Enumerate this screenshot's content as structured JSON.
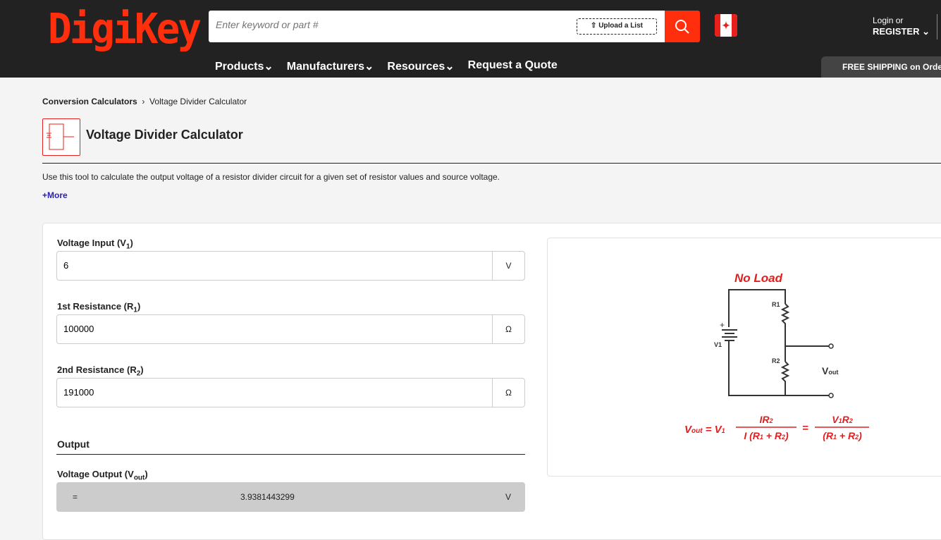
{
  "header": {
    "logo": "DigiKey",
    "search_placeholder": "Enter keyword or part #",
    "upload_label": "Upload a List",
    "login_label": "Login or",
    "register_label": "REGISTER",
    "free_shipping": "FREE SHIPPING on Orders"
  },
  "nav": [
    {
      "label": "Products"
    },
    {
      "label": "Manufacturers"
    },
    {
      "label": "Resources"
    },
    {
      "label": "Request a Quote"
    }
  ],
  "breadcrumb": {
    "parent": "Conversion Calculators",
    "current": "Voltage Divider Calculator"
  },
  "page": {
    "title": "Voltage Divider Calculator",
    "description": "Use this tool to calculate the output voltage of a resistor divider circuit for a given set of resistor values and source voltage.",
    "more": "+More"
  },
  "inputs": [
    {
      "label": "Voltage Input (V",
      "sub": "1",
      "value": "6",
      "unit": "V"
    },
    {
      "label": "1st Resistance (R",
      "sub": "1",
      "value": "100000",
      "unit": "Ω"
    },
    {
      "label": "2nd Resistance (R",
      "sub": "2",
      "value": "191000",
      "unit": "Ω"
    }
  ],
  "output": {
    "heading": "Output",
    "label": "Voltage Output (V",
    "sub": "out",
    "equals": "=",
    "value": "3.9381443299",
    "unit": "V"
  },
  "diagram": {
    "title": "No Load",
    "r1": "R1",
    "r2": "R2",
    "v1": "V1",
    "vout": "V",
    "vout_sub": "out",
    "formula": "Vout = V1 IR2 / I(R1 + R2) = V1R2 / (R1 + R2)"
  },
  "colors": {
    "brand": "#ff2e0d",
    "formula": "#e02020"
  }
}
